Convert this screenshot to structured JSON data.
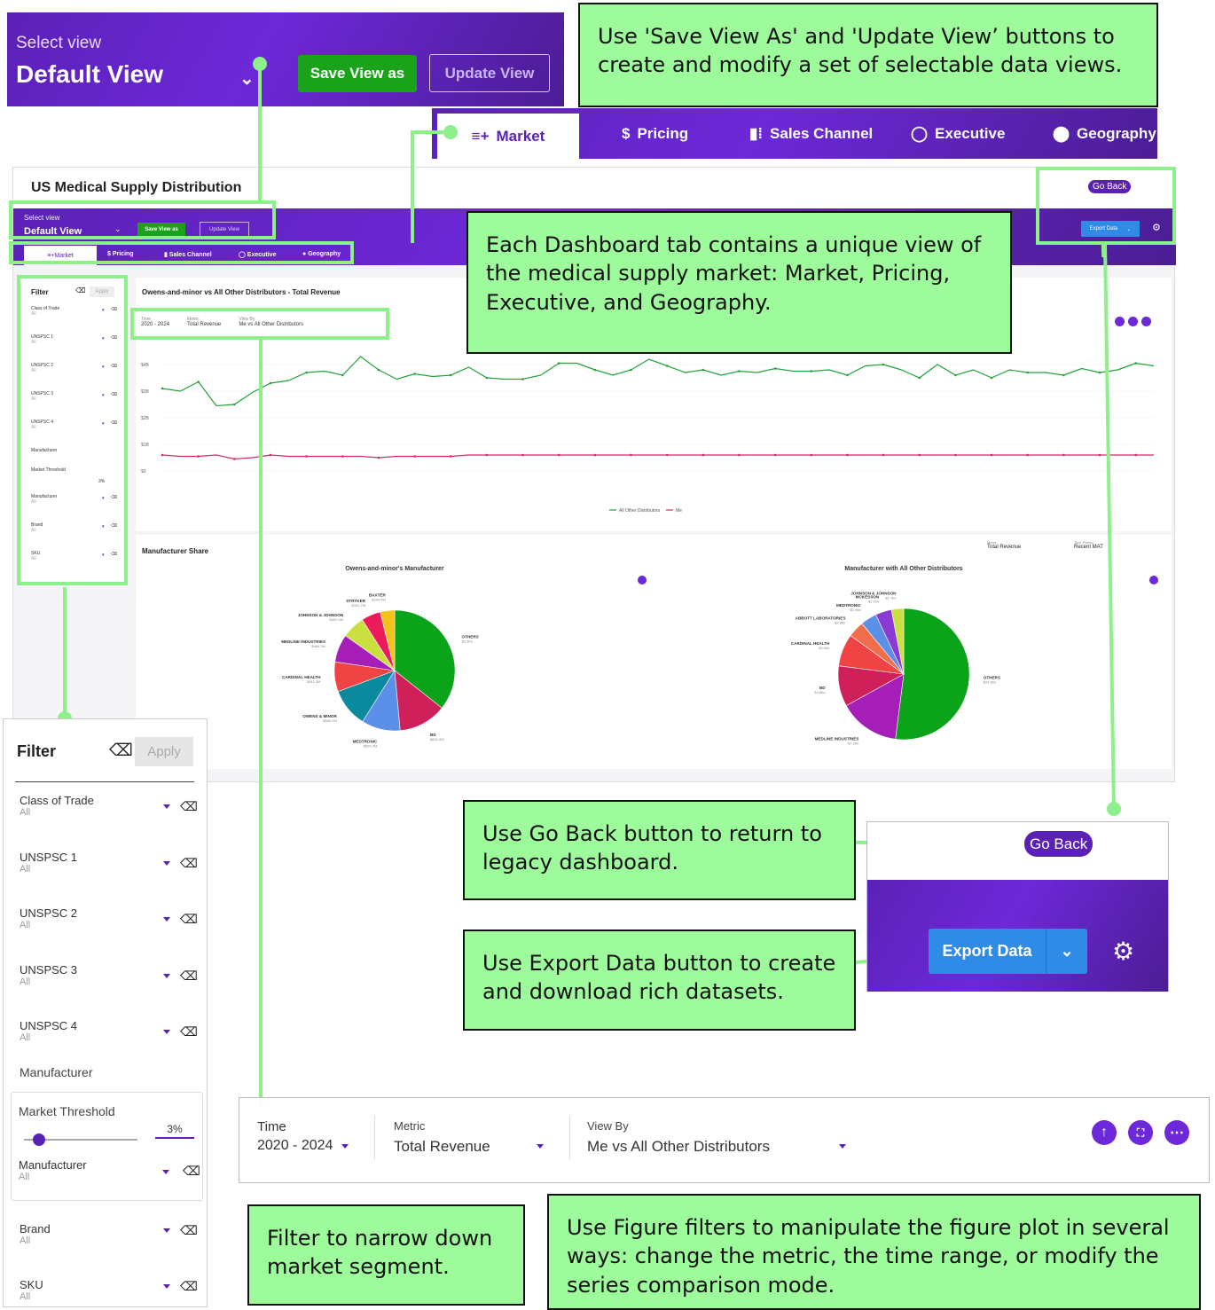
{
  "select_view": {
    "label": "Select view",
    "value": "Default View",
    "save_label": "Save View as",
    "update_label": "Update View"
  },
  "tabs": [
    {
      "icon": "market-icon",
      "label": "Market"
    },
    {
      "icon": "dollar-icon",
      "label": "Pricing"
    },
    {
      "icon": "bar-chart-icon",
      "label": "Sales Channel"
    },
    {
      "icon": "donut-icon",
      "label": "Executive"
    },
    {
      "icon": "location-pin-icon",
      "label": "Geography"
    }
  ],
  "dashboard": {
    "title": "US Medical Supply Distribution",
    "go_back": "Go Back",
    "export": "Export Data",
    "line_chart_title": "Owens-and-minor vs All Other Distributors - Total Revenue",
    "share_title": "Manufacturer Share",
    "share_metric_label": "Metric",
    "share_metric_value": "Total Revenue",
    "share_period_label": "Time Period",
    "share_period_value": "Recent MAT"
  },
  "filter": {
    "title": "Filter",
    "apply": "Apply",
    "items": [
      {
        "label": "Class of Trade",
        "value": "All"
      },
      {
        "label": "UNSPSC 1",
        "value": "All"
      },
      {
        "label": "UNSPSC 2",
        "value": "All"
      },
      {
        "label": "UNSPSC 3",
        "value": "All"
      },
      {
        "label": "UNSPSC 4",
        "value": "All"
      }
    ],
    "manufacturer_heading": "Manufacturer",
    "threshold_label": "Market Threshold",
    "threshold_value": "3%",
    "threshold_fraction": 0.13,
    "manufacturer": {
      "label": "Manufacturer",
      "value": "All"
    },
    "brand": {
      "label": "Brand",
      "value": "All"
    },
    "sku": {
      "label": "SKU",
      "value": "All"
    }
  },
  "figure_filters": {
    "time_label": "Time",
    "time_value": "2020 - 2024",
    "metric_label": "Metric",
    "metric_value": "Total Revenue",
    "viewby_label": "View By",
    "viewby_value": "Me vs All Other Distributors"
  },
  "callouts": {
    "save": "Use 'Save View As' and 'Update View’ buttons to create and modify a set of selectable data views.",
    "tabs": "Each Dashboard tab contains a unique view of the medical supply market: Market, Pricing, Executive, and Geography.",
    "goback": "Use Go Back button to return to legacy dashboard.",
    "export": "Use Export Data button to create and download rich datasets.",
    "filter": "Filter to narrow down market segment.",
    "figure": "Use Figure filters to manipulate the figure plot in several ways: change the metric, the time range, or modify the series comparison mode."
  },
  "chart_data": [
    {
      "type": "line",
      "title": "Owens-and-minor vs All Other Distributors - Total Revenue",
      "y_ticks": [
        "$4B",
        "$3B",
        "$2B",
        "$1B",
        "$0"
      ],
      "ylim": [
        0,
        4.5
      ],
      "legend": [
        "All Other Distributors",
        "Me"
      ],
      "legend_position": "bottom",
      "series": [
        {
          "name": "All Other Distributors",
          "color": "#22a33a",
          "values": [
            3.1,
            3.0,
            3.35,
            2.45,
            2.5,
            2.95,
            3.3,
            3.4,
            3.7,
            3.75,
            3.6,
            4.3,
            3.8,
            3.45,
            3.65,
            3.55,
            3.6,
            3.9,
            3.5,
            3.45,
            3.45,
            3.6,
            4.05,
            4.05,
            3.8,
            3.6,
            3.8,
            4.2,
            3.95,
            3.7,
            3.8,
            3.6,
            3.75,
            3.7,
            3.85,
            3.75,
            3.75,
            3.8,
            3.6,
            3.95,
            4.0,
            3.8,
            3.5,
            4.0,
            3.6,
            3.8,
            3.5,
            3.8,
            3.7,
            3.7,
            3.6,
            3.85,
            3.7,
            3.8,
            4.05,
            3.95
          ]
        },
        {
          "name": "Me",
          "color": "#d42a5c",
          "values": [
            0.6,
            0.55,
            0.55,
            0.6,
            0.45,
            0.5,
            0.6,
            0.55,
            0.55,
            0.55,
            0.55,
            0.55,
            0.5,
            0.55,
            0.55,
            0.55,
            0.55,
            0.6,
            0.6,
            0.6,
            0.6,
            0.6,
            0.6,
            0.6,
            0.6,
            0.6,
            0.6,
            0.6,
            0.6,
            0.6,
            0.6,
            0.6,
            0.6,
            0.6,
            0.6,
            0.6,
            0.6,
            0.6,
            0.6,
            0.6,
            0.6,
            0.6,
            0.6,
            0.6,
            0.6,
            0.6,
            0.6,
            0.6,
            0.6,
            0.6,
            0.6,
            0.6,
            0.6,
            0.6,
            0.6,
            0.6
          ]
        }
      ]
    },
    {
      "type": "pie",
      "title": "Owens-and-minor's Manufacturer",
      "slices": [
        {
          "label": "OTHERS",
          "value": "$2.3bn",
          "share": 30.5,
          "color": "#0aa31a"
        },
        {
          "label": "BD",
          "value": "$822.9M",
          "share": 11.0,
          "color": "#d0205a"
        },
        {
          "label": "MEDTRONIC",
          "value": "$665.2M",
          "share": 8.9,
          "color": "#5b8fe8"
        },
        {
          "label": "OWENS & MINOR",
          "value": "$669.2M",
          "share": 8.9,
          "color": "#0a8a9c"
        },
        {
          "label": "CARDINAL HEALTH",
          "value": "$511.3M",
          "share": 6.8,
          "color": "#f04444"
        },
        {
          "label": "MEDLINE INDUSTRIES",
          "value": "$484.3M",
          "share": 6.4,
          "color": "#a51eb8"
        },
        {
          "label": "JOHNSON & JOHNSON",
          "value": "$400.4M",
          "share": 5.3,
          "color": "#c9e040"
        },
        {
          "label": "STRYKER",
          "value": "$331.7M",
          "share": 4.4,
          "color": "#ec1c5c"
        },
        {
          "label": "BAXTER",
          "value": "$244.4M",
          "share": 3.3,
          "color": "#f2c21b"
        }
      ]
    },
    {
      "type": "pie",
      "title": "Manufacturer with All Other Distributors",
      "slices": [
        {
          "label": "OTHERS",
          "value": "$24.8bn",
          "share": 52,
          "color": "#0aa31a"
        },
        {
          "label": "MEDLINE INDUSTRIES",
          "value": "$7.2bn",
          "share": 15,
          "color": "#a51eb8"
        },
        {
          "label": "BD",
          "value": "$4.8bn",
          "share": 10,
          "color": "#d0205a"
        },
        {
          "label": "CARDINAL HEALTH",
          "value": "$3.8bn",
          "share": 8,
          "color": "#f04444"
        },
        {
          "label": "ABBOTT LABORATORIES",
          "value": "$2.8bn",
          "share": 4,
          "color": "#f26d4a"
        },
        {
          "label": "MEDTRONIC",
          "value": "$1.9bn",
          "share": 4,
          "color": "#5b8fe8"
        },
        {
          "label": "MCKESSON",
          "value": "$1.7bn",
          "share": 4,
          "color": "#8b3ad6"
        },
        {
          "label": "JOHNSON & JOHNSON",
          "value": "$1.7bn",
          "share": 3,
          "color": "#c9e040"
        }
      ]
    }
  ]
}
